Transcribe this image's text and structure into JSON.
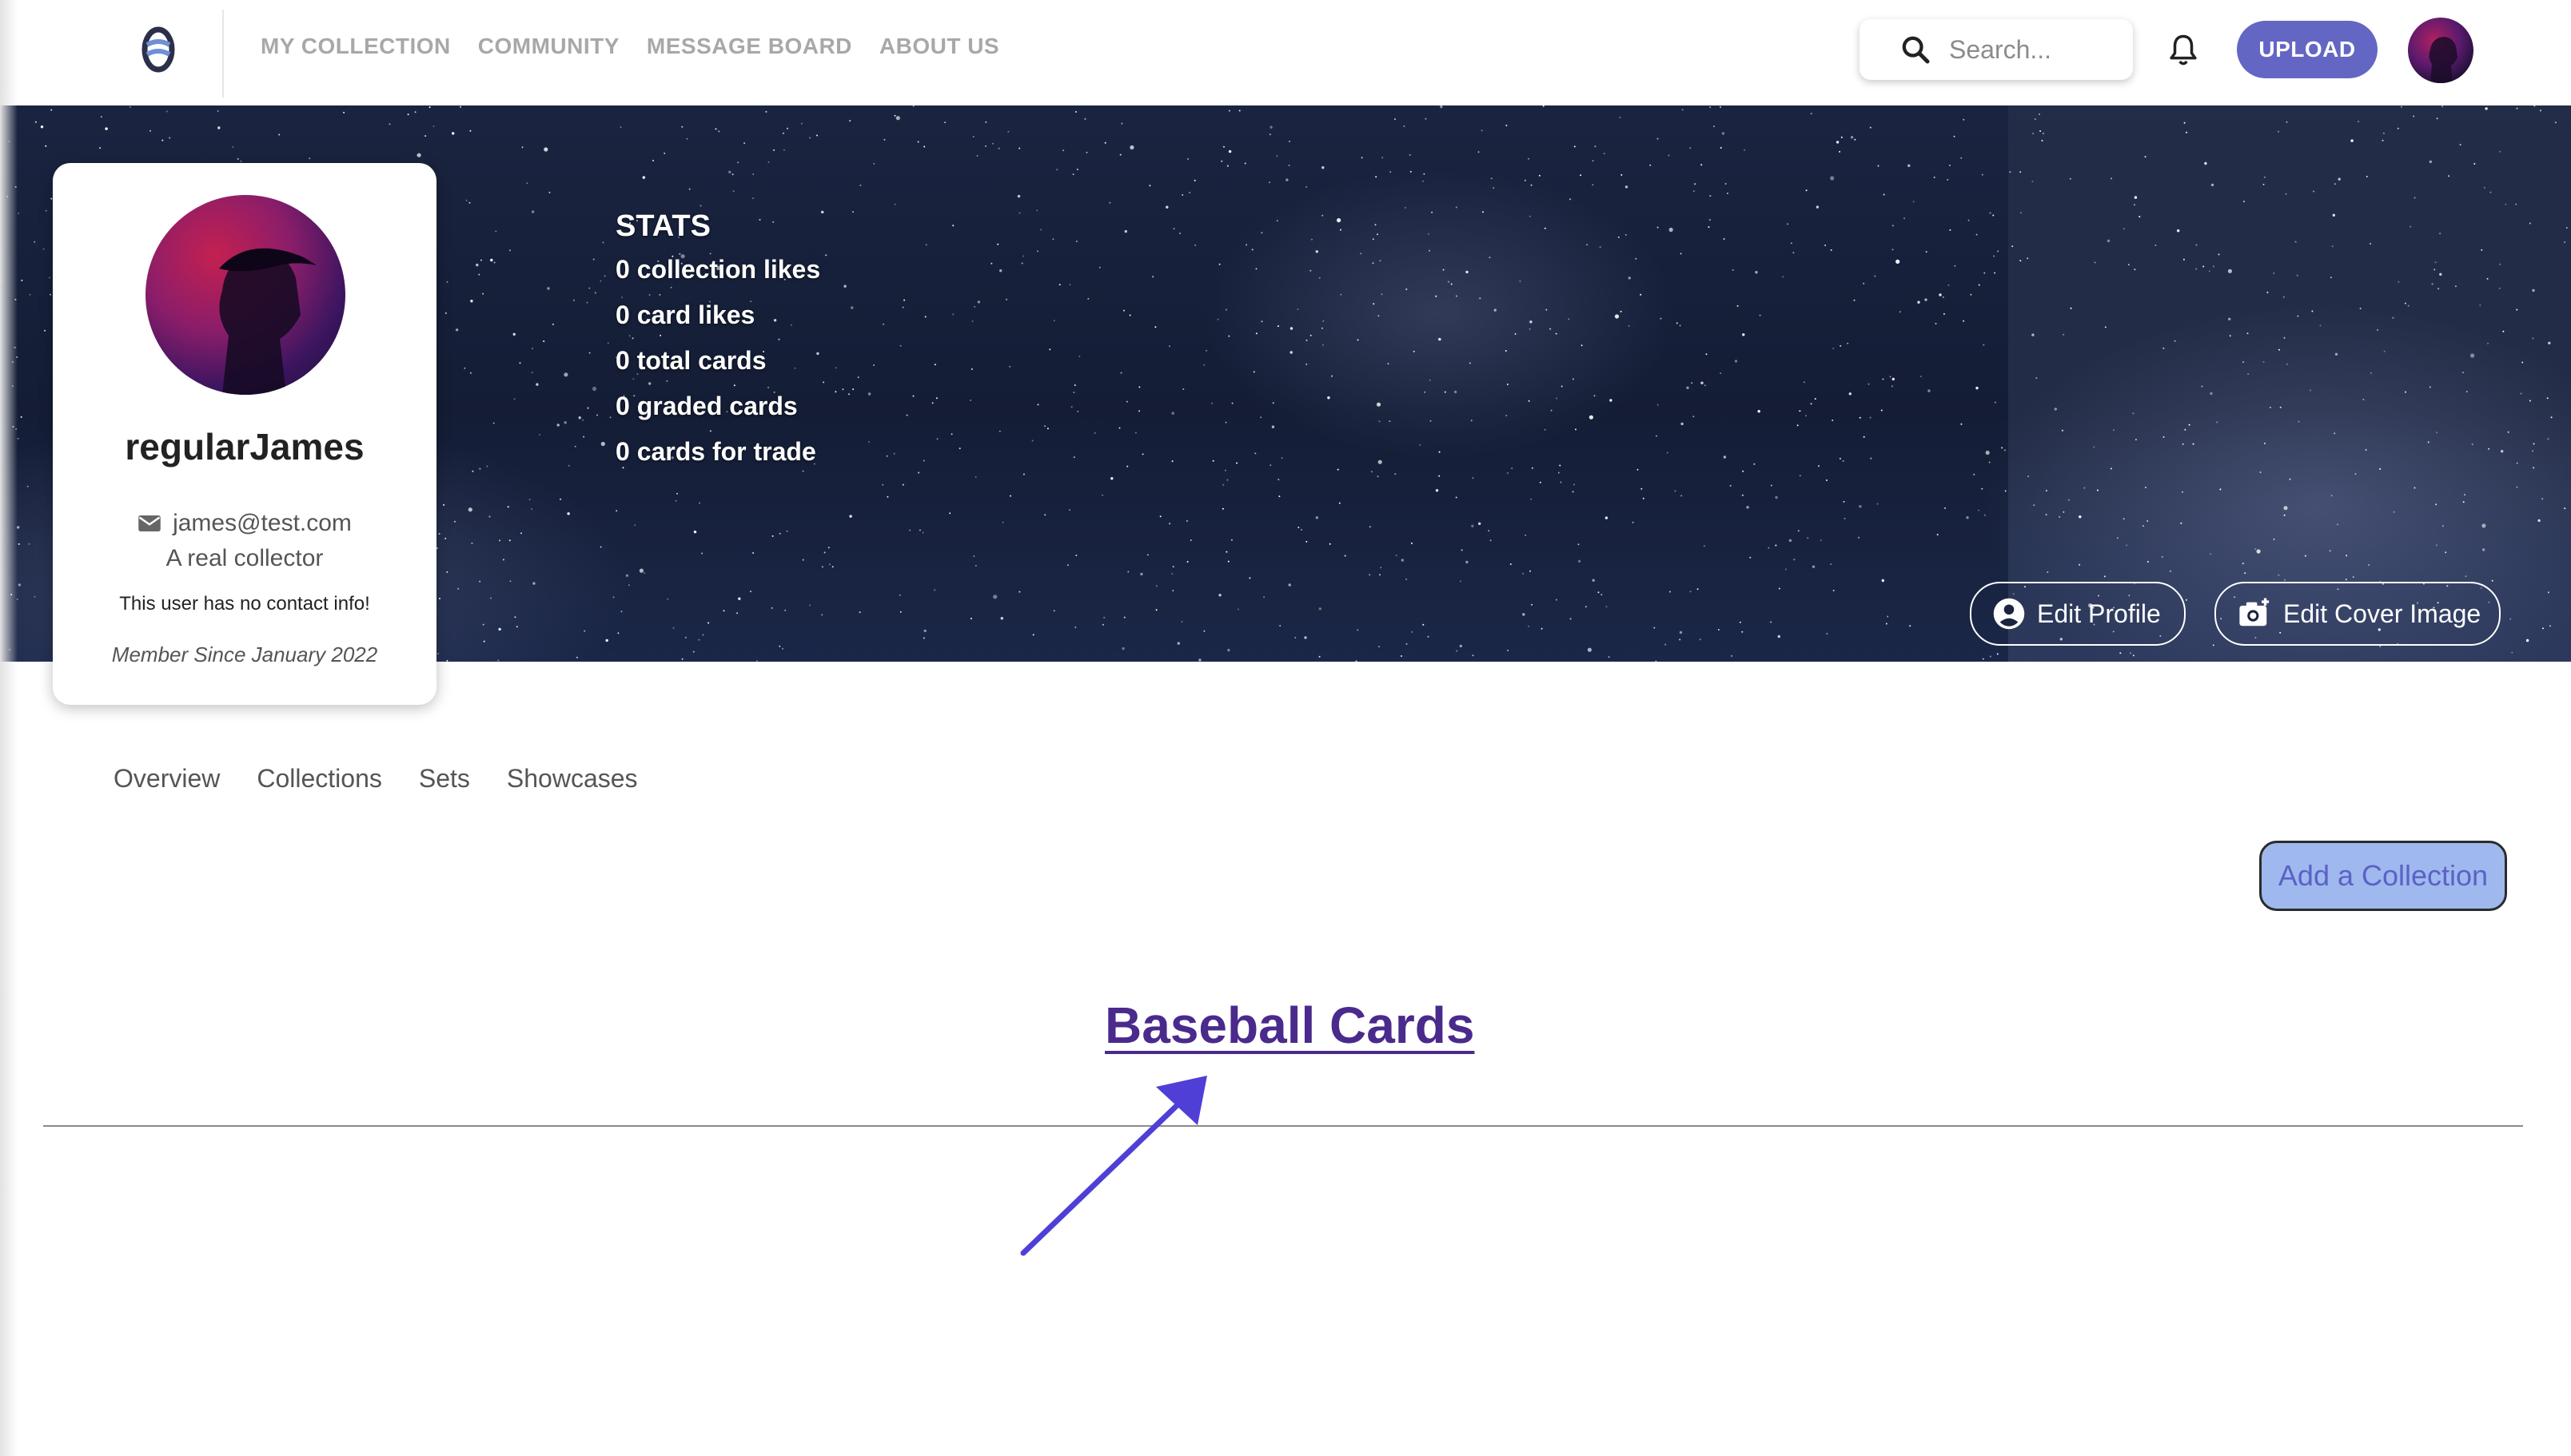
{
  "nav": {
    "links": [
      "MY COLLECTION",
      "COMMUNITY",
      "MESSAGE BOARD",
      "ABOUT US"
    ],
    "search_placeholder": "Search...",
    "upload_label": "UPLOAD"
  },
  "cover": {
    "stats_title": "STATS",
    "stats": [
      "0 collection likes",
      "0 card likes",
      "0 total cards",
      "0 graded cards",
      "0 cards for trade"
    ],
    "edit_profile_label": "Edit Profile",
    "edit_cover_label": "Edit Cover Image"
  },
  "profile": {
    "username": "regularJames",
    "email": "james@test.com",
    "tagline": "A real collector",
    "contact": "This user has no contact info!",
    "member_since": "Member Since January 2022"
  },
  "tabs": [
    "Overview",
    "Collections",
    "Sets",
    "Showcases"
  ],
  "add_collection_label": "Add a Collection",
  "collection_title": "Baseball Cards",
  "colors": {
    "accent": "#6466c4",
    "link": "#4a2a8c",
    "add_button": "#9fb8ee",
    "annotation_arrow": "#4f3fd6"
  }
}
